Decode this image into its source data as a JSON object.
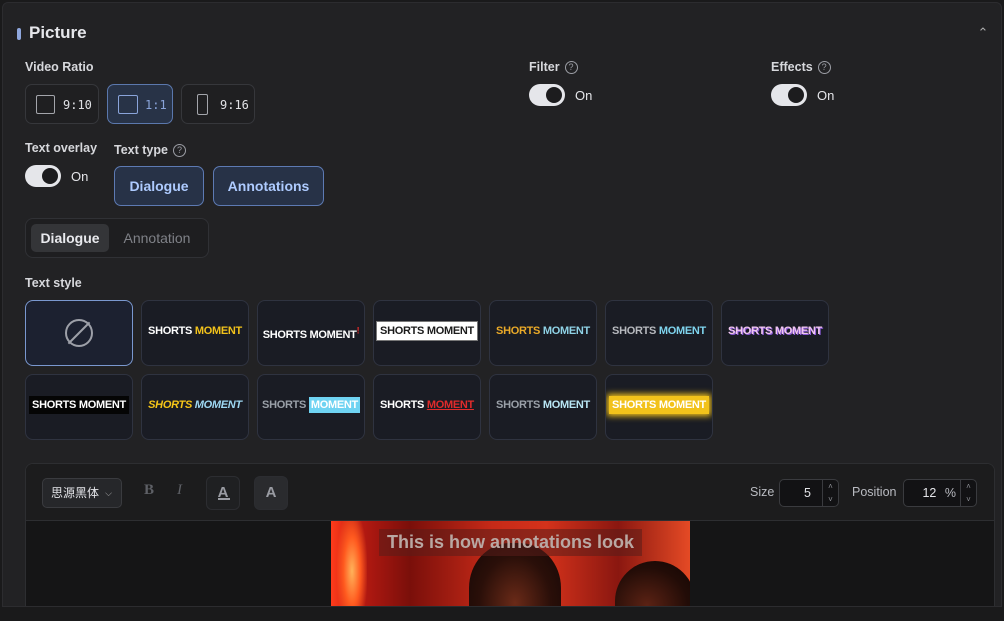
{
  "section": {
    "title": "Picture",
    "collapse_icon": "chevron-up-icon"
  },
  "video_ratio": {
    "label": "Video Ratio",
    "options": [
      {
        "label": "9:10",
        "selected": false
      },
      {
        "label": "1:1",
        "selected": true
      },
      {
        "label": "9:16",
        "selected": false
      }
    ]
  },
  "filter": {
    "label": "Filter",
    "state": "On",
    "help_icon": "help-icon"
  },
  "effects": {
    "label": "Effects",
    "state": "On",
    "help_icon": "help-icon"
  },
  "text_overlay": {
    "label": "Text overlay",
    "state": "On"
  },
  "text_type": {
    "label": "Text type",
    "options": [
      "Dialogue",
      "Annotations"
    ]
  },
  "mode_tabs": {
    "active": "Dialogue",
    "inactive": "Annotation"
  },
  "text_style": {
    "label": "Text style",
    "none_icon": "none-icon",
    "styles": [
      {
        "part1": "SHORTS",
        "part2": "MOMENT",
        "c1": "#ffffff",
        "c2": "#f2c21b"
      },
      {
        "part1": "SHORTS",
        "part2": "MOMENT",
        "c1": "#ffffff",
        "c2": "#ffffff",
        "mark": "!"
      },
      {
        "part1": "SHORTS",
        "part2": "MOMENT",
        "c1": "#1b1b1b",
        "c2": "#1b1b1b",
        "bg": "#ffffff"
      },
      {
        "part1": "SHORTS",
        "part2": "MOMENT",
        "c1": "#e9a928",
        "c2": "#8fd2e6"
      },
      {
        "part1": "SHORTS",
        "part2": "MOMENT",
        "c1": "#b7b9be",
        "c2": "#7fd4ee"
      },
      {
        "part1": "SHORTS",
        "part2": "MOMENT",
        "c1": "#f0c6ef",
        "c2": "#f0c6ef",
        "shadow": "#8c5ad8"
      },
      {
        "part1": "SHORTS",
        "part2": "MOMENT",
        "c1": "#ffffff",
        "c2": "#ffffff",
        "bg": "#050505"
      },
      {
        "part1": "SHORTS",
        "part2": "MOMENT",
        "c1": "#f5c518",
        "c2": "#9ed8f3"
      },
      {
        "part1": "SHORTS",
        "part2": "MOMENT",
        "c1": "#9aa0a8",
        "c2": "#ffffff",
        "bg2": "#6fd3f2"
      },
      {
        "part1": "SHORTS",
        "part2": "MOMENT",
        "c1": "#ffffff",
        "c2": "#e02b2b"
      },
      {
        "part1": "SHORTS",
        "part2": "MOMENT",
        "c1": "#9aa0a8",
        "c2": "#b9e6f5"
      },
      {
        "part1": "SHORTS",
        "part2": "MOMENT",
        "c1": "#ffffff",
        "c2": "#ffffff",
        "bg": "#f2c21b"
      }
    ]
  },
  "editor": {
    "font": "思源黑体",
    "bold_label": "B",
    "italic_label": "I",
    "color_label": "A",
    "bg_label": "A",
    "size_label": "Size",
    "size_value": "5",
    "position_label": "Position",
    "position_value": "12",
    "position_unit": "%",
    "preview_text": "This is how annotations look"
  }
}
